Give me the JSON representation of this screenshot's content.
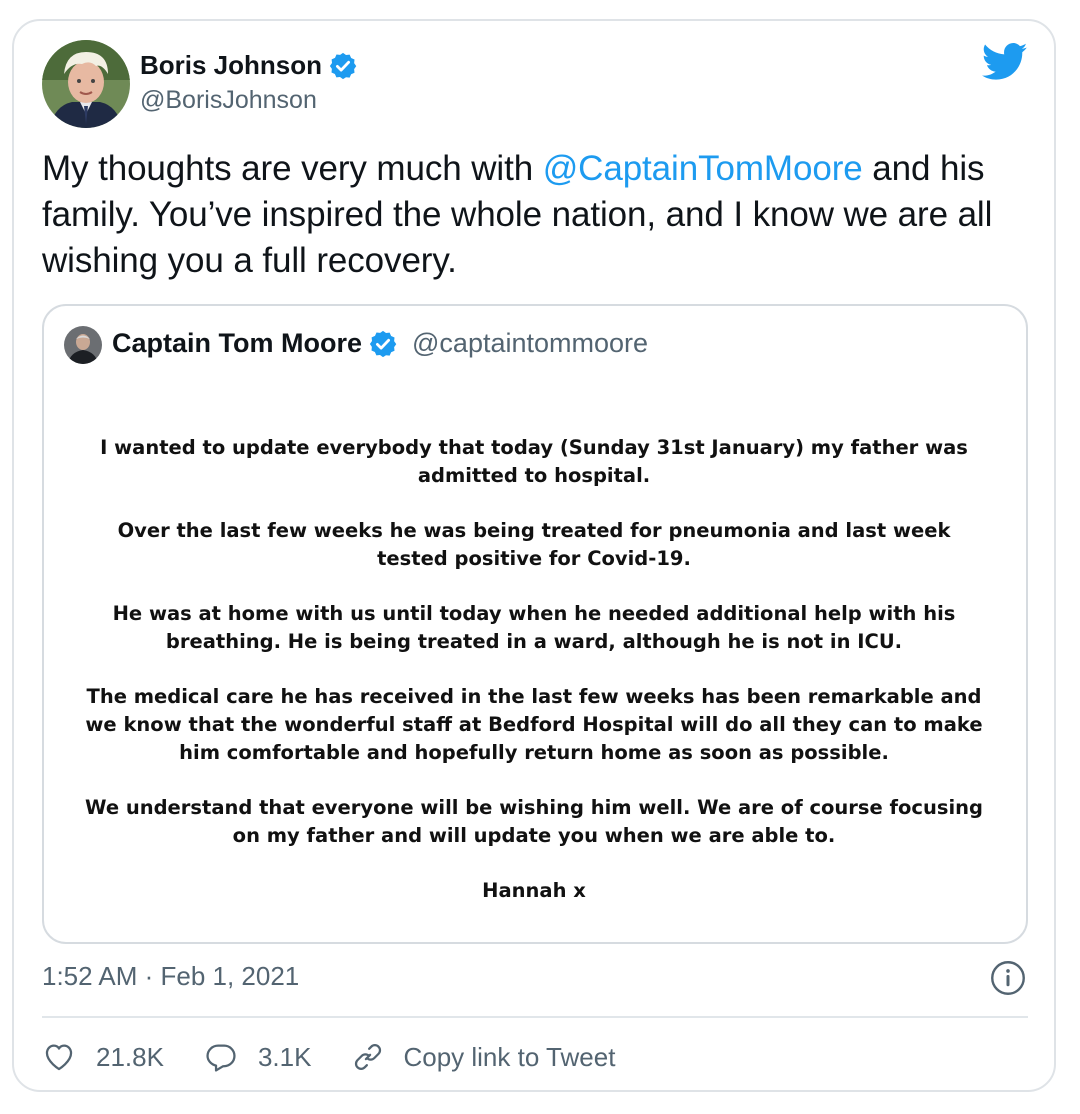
{
  "tweet": {
    "author_name": "Boris Johnson",
    "author_handle": "@BorisJohnson",
    "text_before": "My thoughts are very much with ",
    "mention": "@CaptainTomMoore",
    "text_after": " and his family. You’ve inspired the whole nation, and I know we are all wishing you a full recovery.",
    "timestamp": "1:52 AM · Feb 1, 2021"
  },
  "quoted": {
    "author_name": "Captain Tom Moore",
    "author_handle": "@captaintommoore",
    "paragraphs": [
      "I wanted to update everybody that today (Sunday 31st January) my father was admitted to hospital.",
      "Over the last few weeks he was being treated for pneumonia and last week tested positive for Covid-19.",
      "He was at home with us until today when he needed additional help with his breathing. He is being treated in a ward, although he is not in ICU.",
      "The medical care he has received in the last few weeks has been remarkable and we know that the wonderful staff at Bedford Hospital will do all they can to make him comfortable and hopefully return home as soon as possible.",
      "We understand that everyone will be wishing him well. We are of course focusing on my father and will update you when we are able to.",
      "Hannah x"
    ]
  },
  "actions": {
    "likes": "21.8K",
    "replies": "3.1K",
    "copy_link": "Copy link to Tweet"
  },
  "icons": {
    "brand": "twitter-bird-icon",
    "verified": "verified-badge-icon",
    "info": "info-icon",
    "like": "heart-icon",
    "reply": "reply-bubble-icon",
    "link": "link-icon"
  },
  "colors": {
    "accent": "#1d9bf0",
    "secondary_text": "#536471",
    "border": "#dfe3e7"
  }
}
